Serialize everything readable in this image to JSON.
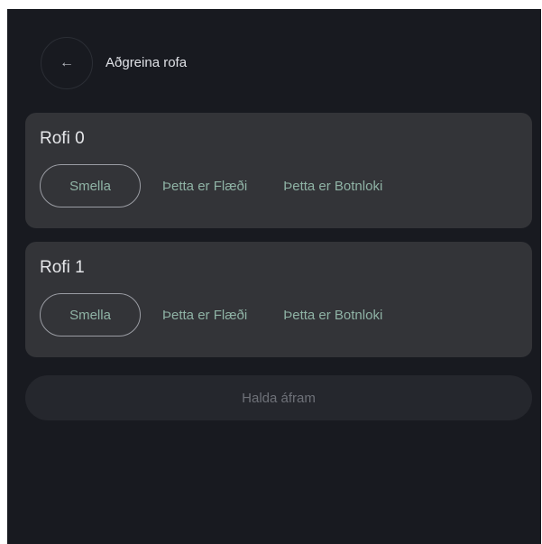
{
  "header": {
    "back_icon": "←",
    "title": "Aðgreina rofa"
  },
  "cards": [
    {
      "title": "Rofi 0",
      "click_label": "Smella",
      "flow_label": "Þetta er Flæði",
      "bottom_label": "Þetta er Botnloki"
    },
    {
      "title": "Rofi 1",
      "click_label": "Smella",
      "flow_label": "Þetta er Flæði",
      "bottom_label": "Þetta er Botnloki"
    }
  ],
  "footer": {
    "continue_label": "Halda áfram"
  },
  "colors": {
    "background": "#181a20",
    "card": "#333438",
    "accent_text": "#8fb3a5",
    "disabled_button": "#25272d"
  }
}
